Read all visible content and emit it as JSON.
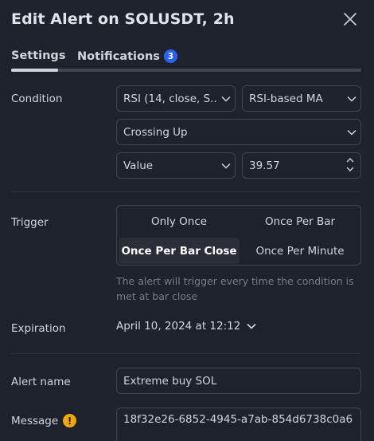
{
  "dialog": {
    "title": "Edit Alert on SOLUSDT, 2h",
    "close_icon": "close-icon"
  },
  "tabs": [
    {
      "label": "Settings",
      "active": true
    },
    {
      "label": "Notifications",
      "badge": "3"
    }
  ],
  "condition": {
    "label": "Condition",
    "source_select": "RSI (14, close, S...",
    "target_select": "RSI-based MA",
    "operator_select": "Crossing Up",
    "value_type_select": "Value",
    "value_input": "39.57"
  },
  "trigger": {
    "label": "Trigger",
    "options": [
      "Only Once",
      "Once Per Bar",
      "Once Per Bar Close",
      "Once Per Minute"
    ],
    "selected": "Once Per Bar Close",
    "hint": "The alert will trigger every time the condition is met at bar close"
  },
  "expiration": {
    "label": "Expiration",
    "value": "April 10, 2024 at 12:12"
  },
  "alert_name": {
    "label": "Alert name",
    "value": "Extreme buy SOL"
  },
  "message": {
    "label": "Message",
    "value": "18f32e26-6852-4945-a7ab-854d6738c0a6"
  },
  "colors": {
    "background": "#1e222d",
    "border": "#434651",
    "accent": "#2962ff",
    "warning": "#f7a600",
    "muted_text": "#787b86"
  }
}
